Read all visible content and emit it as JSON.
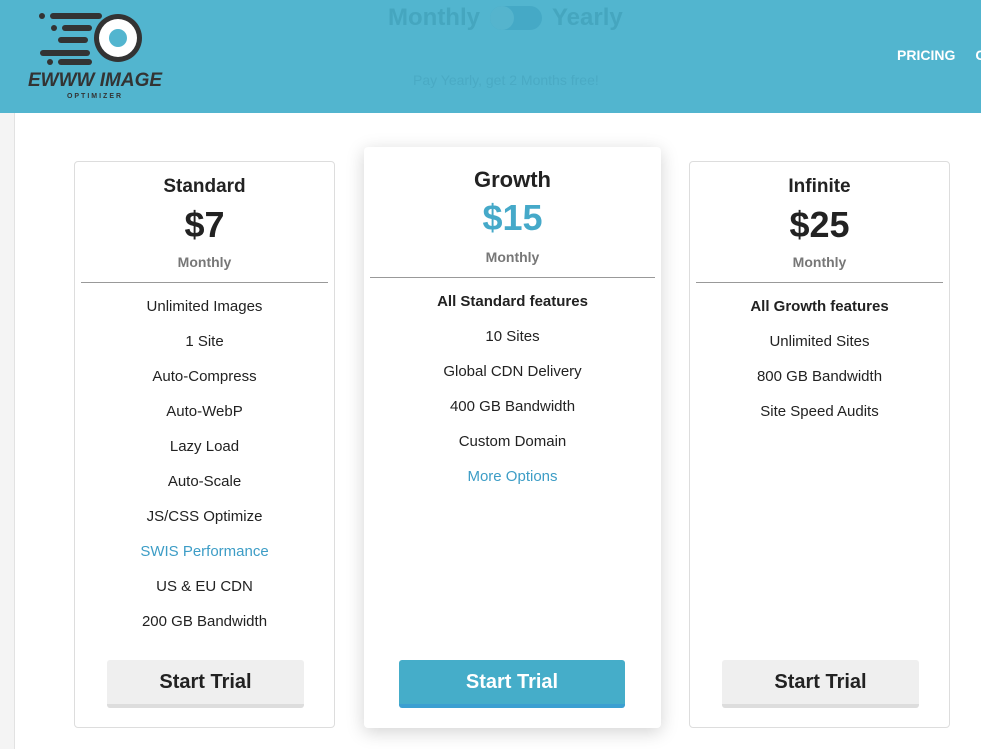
{
  "header": {
    "logo": {
      "text": "EWWW IMAGE",
      "subtext": "OPTIMIZER"
    },
    "toggle": {
      "left_label": "Monthly",
      "right_label": "Yearly",
      "state": "monthly"
    },
    "promo": "Pay Yearly, get 2 Months free!",
    "nav": [
      "PRICING",
      "C"
    ]
  },
  "plans": [
    {
      "name": "Standard",
      "price": "$7",
      "period": "Monthly",
      "features": [
        "Unlimited Images",
        "1 Site",
        "Auto-Compress",
        "Auto-WebP",
        "Lazy Load",
        "Auto-Scale",
        "JS/CSS Optimize",
        "SWIS Performance",
        "US & EU CDN",
        "200 GB Bandwidth"
      ],
      "button": "Start Trial"
    },
    {
      "name": "Growth",
      "price": "$15",
      "period": "Monthly",
      "features": [
        "All Standard features",
        "10 Sites",
        "Global CDN Delivery",
        "400 GB Bandwidth",
        "Custom Domain",
        "More Options"
      ],
      "button": "Start Trial"
    },
    {
      "name": "Infinite",
      "price": "$25",
      "period": "Monthly",
      "features": [
        "All Growth features",
        "Unlimited Sites",
        "800 GB Bandwidth",
        "Site Speed Audits"
      ],
      "button": "Start Trial"
    }
  ],
  "colors": {
    "header": "#52b5cf",
    "accent": "#45adc9",
    "link": "#3d9dc6"
  }
}
